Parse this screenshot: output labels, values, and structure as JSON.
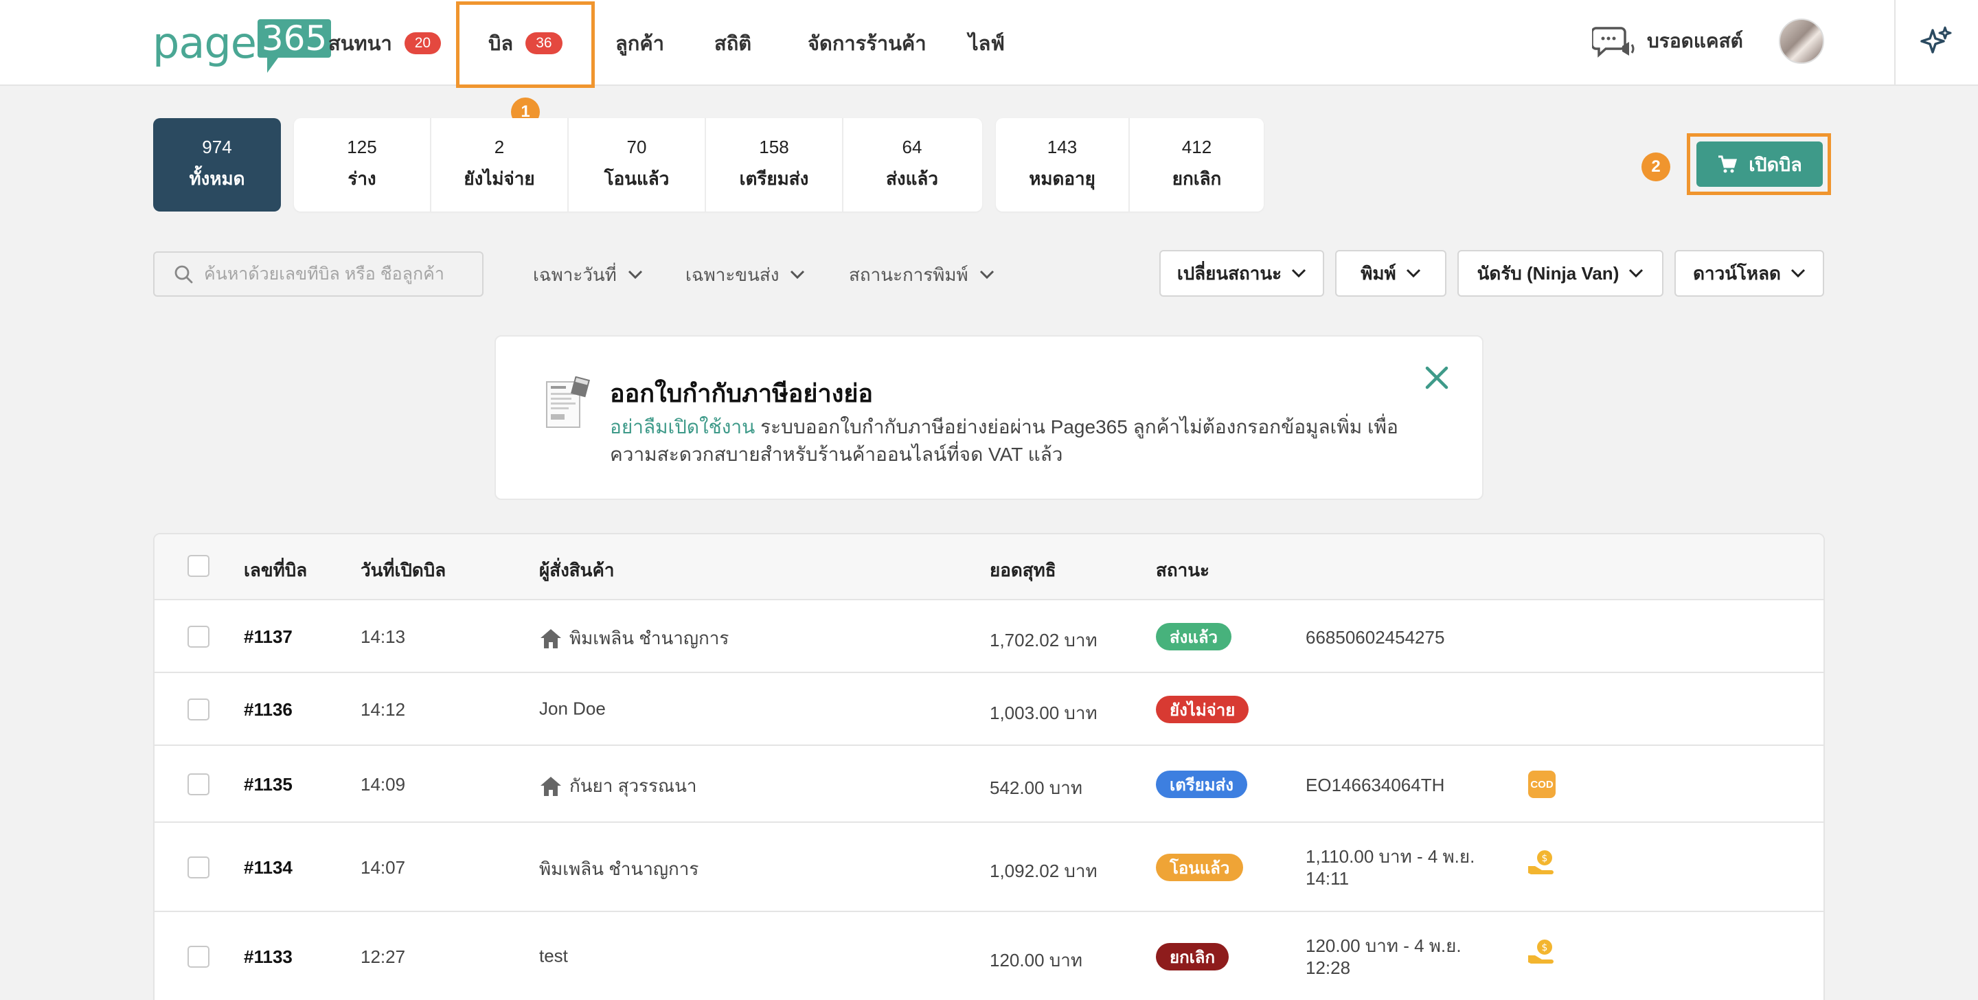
{
  "nav": {
    "logo_text": "page",
    "logo_box": "365",
    "items": [
      {
        "label": "สนทนา",
        "badge": "20"
      },
      {
        "label": "บิล",
        "badge": "36"
      },
      {
        "label": "ลูกค้า"
      },
      {
        "label": "สถิติ"
      },
      {
        "label": "จัดการร้านค้า"
      },
      {
        "label": "ไลฟ์"
      }
    ],
    "broadcast_label": "บรอดแคสต์",
    "step1": "1",
    "step2": "2"
  },
  "summary": {
    "all": {
      "count": "974",
      "label": "ทั้งหมด"
    },
    "group1": [
      {
        "count": "125",
        "label": "ร่าง"
      },
      {
        "count": "2",
        "label": "ยังไม่จ่าย"
      },
      {
        "count": "70",
        "label": "โอนแล้ว"
      },
      {
        "count": "158",
        "label": "เตรียมส่ง"
      },
      {
        "count": "64",
        "label": "ส่งแล้ว"
      }
    ],
    "group2": [
      {
        "count": "143",
        "label": "หมดอายุ"
      },
      {
        "count": "412",
        "label": "ยกเลิก"
      }
    ]
  },
  "open_bill_label": "เปิดบิล",
  "filters": {
    "search_placeholder": "ค้นหาด้วยเลขที่บิล หรือ ชื่อลูกค้า",
    "date": "เฉพาะวันที่",
    "shipping": "เฉพาะขนส่ง",
    "print_status": "สถานะการพิมพ์",
    "change_status": "เปลี่ยนสถานะ",
    "print": "พิมพ์",
    "pickup": "นัดรับ (Ninja Van)",
    "download": "ดาวน์โหลด"
  },
  "banner": {
    "title": "ออกใบกำกับภาษีอย่างย่อ",
    "highlight": "อย่าลืมเปิดใช้งาน",
    "body": " ระบบออกใบกำกับภาษีอย่างย่อผ่าน Page365 ลูกค้าไม่ต้องกรอกข้อมูลเพิ่ม เพื่อความสะดวกสบายสำหรับร้านค้าออนไลน์ที่จด VAT แล้ว"
  },
  "table": {
    "headers": {
      "bill_no": "เลขที่บิล",
      "date": "วันที่เปิดบิล",
      "customer": "ผู้สั่งสินค้า",
      "total": "ยอดสุทธิ",
      "status": "สถานะ"
    },
    "rows": [
      {
        "bill": "#1137",
        "time": "14:13",
        "customer": "พิมเพลิน ชำนาญการ",
        "home": true,
        "total": "1,702.02 บาท",
        "status": "ส่งแล้ว",
        "status_color": "#47b27c",
        "info": "66850602454275",
        "info2": "",
        "extra": ""
      },
      {
        "bill": "#1136",
        "time": "14:12",
        "customer": "Jon Doe",
        "home": false,
        "total": "1,003.00 บาท",
        "status": "ยังไม่จ่าย",
        "status_color": "#d83a32",
        "info": "",
        "info2": "",
        "extra": ""
      },
      {
        "bill": "#1135",
        "time": "14:09",
        "customer": "กันยา สุวรรณนา",
        "home": true,
        "total": "542.00 บาท",
        "status": "เตรียมส่ง",
        "status_color": "#3d7fe0",
        "info": "EO146634064TH",
        "info2": "",
        "extra": "COD"
      },
      {
        "bill": "#1134",
        "time": "14:07",
        "customer": "พิมเพลิน ชำนาญการ",
        "home": false,
        "total": "1,092.02 บาท",
        "status": "โอนแล้ว",
        "status_color": "#efa436",
        "info": "1,110.00 บาท - 4 พ.ย.",
        "info2": "14:11",
        "extra": "coin"
      },
      {
        "bill": "#1133",
        "time": "12:27",
        "customer": "test",
        "home": false,
        "total": "120.00 บาท",
        "status": "ยกเลิก",
        "status_color": "#8e1c1c",
        "info": "120.00 บาท - 4 พ.ย.",
        "info2": "12:28",
        "extra": "coin"
      }
    ]
  },
  "colors": {
    "accent": "#3e9a89",
    "highlight": "#f0952e",
    "badge": "#e4483f",
    "dark_card": "#2b4a60"
  }
}
